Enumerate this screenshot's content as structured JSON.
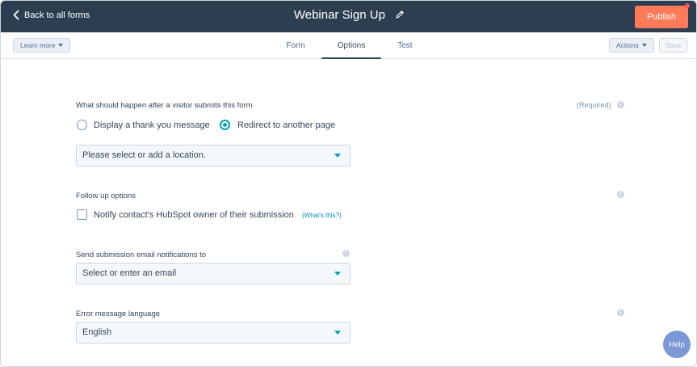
{
  "header": {
    "back_label": "Back to all forms",
    "title": "Webinar Sign Up",
    "publish_label": "Publish"
  },
  "subbar": {
    "learn_more_label": "Learn more",
    "tabs": [
      {
        "label": "Form",
        "active": false
      },
      {
        "label": "Options",
        "active": true
      },
      {
        "label": "Test",
        "active": false
      }
    ],
    "actions_label": "Actions",
    "save_label": "Save"
  },
  "options": {
    "after_submit": {
      "label": "What should happen after a visitor submits this form",
      "required_label": "(Required)",
      "choices": [
        {
          "label": "Display a thank you message",
          "selected": false
        },
        {
          "label": "Redirect to another page",
          "selected": true
        }
      ],
      "location_placeholder": "Please select or add a location."
    },
    "follow_up": {
      "label": "Follow up options",
      "checkbox_label": "Notify contact's HubSpot owner of their submission",
      "checked": false,
      "whats_this": "(What's this?)"
    },
    "notifications": {
      "label": "Send submission email notifications to",
      "placeholder": "Select or enter an email"
    },
    "language": {
      "label": "Error message language",
      "value": "English"
    }
  },
  "help_label": "Help",
  "colors": {
    "header_bg": "#2d3e50",
    "publish": "#ff7a59",
    "accent": "#00a4bd",
    "help": "#7c98d6"
  }
}
